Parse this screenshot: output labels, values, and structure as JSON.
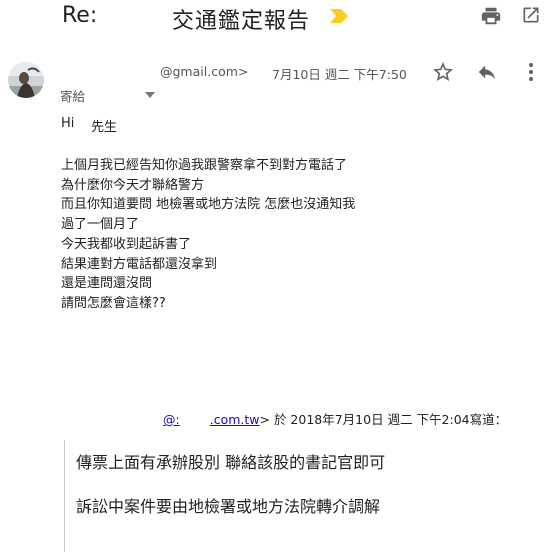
{
  "header": {
    "re_prefix": "Re:",
    "subject": "交通鑑定報告",
    "importance_icon": "importance-marker-icon",
    "print_icon": "print-icon",
    "new_window_icon": "open-in-new-window-icon",
    "accent_color": "#fbcf1d"
  },
  "message": {
    "sender_email": "@gmail.com>",
    "date": "7月10日 週二 下午7:50",
    "to_label": "寄給",
    "greeting_hi": "Hi",
    "greeting_name": "先生",
    "lines": [
      "上個月我已經告知你過我跟警察拿不到對方電話了",
      "為什麼你今天才聯絡警方",
      "而且你知道要問 地檢署或地方法院 怎麼也沒通知我",
      "過了一個月了",
      "今天我都收到起訴書了",
      "結果連對方電話都還沒拿到",
      "還是連問還沒問",
      "請問怎麼會這樣??"
    ]
  },
  "quoted": {
    "at": "@:",
    "domain": ".com.tw",
    "rest": "> 於 2018年7月10日 週二 下午2:04寫道：",
    "line1": "傳票上面有承辦股別  聯絡該股的書記官即可",
    "line2": "訴訟中案件要由地檢署或地方法院轉介調解",
    "link_color": "#1a0dab"
  }
}
